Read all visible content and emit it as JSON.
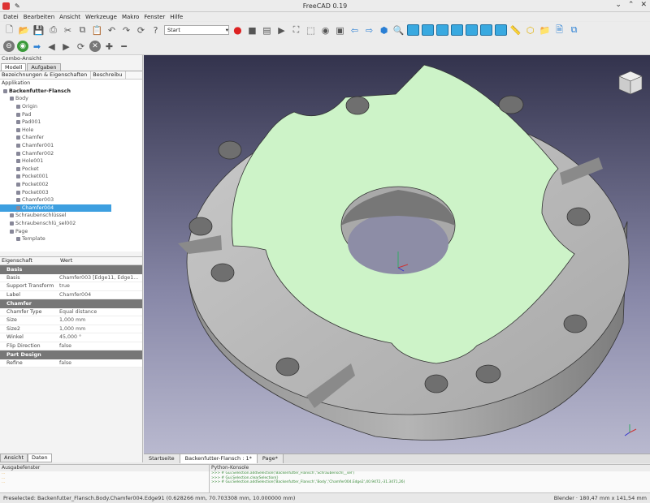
{
  "window": {
    "title": "FreeCAD 0.19"
  },
  "menu": [
    "Datei",
    "Bearbeiten",
    "Ansicht",
    "Werkzeuge",
    "Makro",
    "Fenster",
    "Hilfe"
  ],
  "toolbar": {
    "workbench": "Start"
  },
  "combo": {
    "title": "Combo-Ansicht",
    "tabs": [
      "Modell",
      "Aufgaben"
    ],
    "tree_headers": [
      "Bezeichnungen & Eigenschaften",
      "Beschreibu"
    ],
    "app_label": "Applikation"
  },
  "tree": [
    {
      "label": "Backenfutter-Flansch",
      "indent": 0,
      "root": true
    },
    {
      "label": "Body",
      "indent": 1
    },
    {
      "label": "Origin",
      "indent": 2
    },
    {
      "label": "Pad",
      "indent": 2
    },
    {
      "label": "Pad001",
      "indent": 2
    },
    {
      "label": "Hole",
      "indent": 2
    },
    {
      "label": "Chamfer",
      "indent": 2
    },
    {
      "label": "Chamfer001",
      "indent": 2
    },
    {
      "label": "Chamfer002",
      "indent": 2
    },
    {
      "label": "Hole001",
      "indent": 2
    },
    {
      "label": "Pocket",
      "indent": 2
    },
    {
      "label": "Pocket001",
      "indent": 2
    },
    {
      "label": "Pocket002",
      "indent": 2
    },
    {
      "label": "Pocket003",
      "indent": 2
    },
    {
      "label": "Chamfer003",
      "indent": 2
    },
    {
      "label": "Chamfer004",
      "indent": 2,
      "selected": true
    },
    {
      "label": "Schraubenschlüssel",
      "indent": 1
    },
    {
      "label": "Schraubenschlü_sel002",
      "indent": 1
    },
    {
      "label": "Page",
      "indent": 1
    },
    {
      "label": "Template",
      "indent": 2
    }
  ],
  "props": {
    "headers": [
      "Eigenschaft",
      "Wert"
    ],
    "groups": [
      {
        "name": "Basis",
        "rows": [
          [
            "Basis",
            "Chamfer003 [Edge11, Edge1..."
          ],
          [
            "Support Transform",
            "true"
          ],
          [
            "Label",
            "Chamfer004"
          ]
        ]
      },
      {
        "name": "Chamfer",
        "rows": [
          [
            "Chamfer Type",
            "Equal distance"
          ],
          [
            "Size",
            "1,000 mm"
          ],
          [
            "Size2",
            "1,000 mm"
          ],
          [
            "Winkel",
            "45,000 °"
          ],
          [
            "Flip Direction",
            "false"
          ]
        ]
      },
      {
        "name": "Part Design",
        "rows": [
          [
            "Refine",
            "false"
          ]
        ]
      }
    ]
  },
  "bottom_tabs": [
    "Ansicht",
    "Daten"
  ],
  "doc_tabs": [
    "Startseite",
    "Backenfutter-Flansch : 1*",
    "Page*"
  ],
  "output": {
    "title": "Ausgabefenster",
    "lines": [
      "...",
      "...",
      "..."
    ]
  },
  "python": {
    "title": "Python-Konsole",
    "lines": [
      ">>> # Gui.Selection.addSelection('Backenfutter_Flansch','Schraubenschl__sel')",
      ">>> # Gui.Selection.clearSelection()",
      ">>> # Gui.Selection.addSelection('Backenfutter_Flansch','Body','Chamfer004.Edge2',40.9472,-31.3471,26)"
    ]
  },
  "status": {
    "preselected": "Preselected: Backenfutter_Flansch.Body.Chamfer004.Edge91 (0.628266 mm, 70.703308 mm, 10.000000 mm)",
    "right": "Blender · 180,47 mm x 141,54 mm"
  },
  "colors": {
    "face": "#cdf3c8",
    "metal": "#a9a9a9",
    "selection": "#3d9fe0"
  }
}
